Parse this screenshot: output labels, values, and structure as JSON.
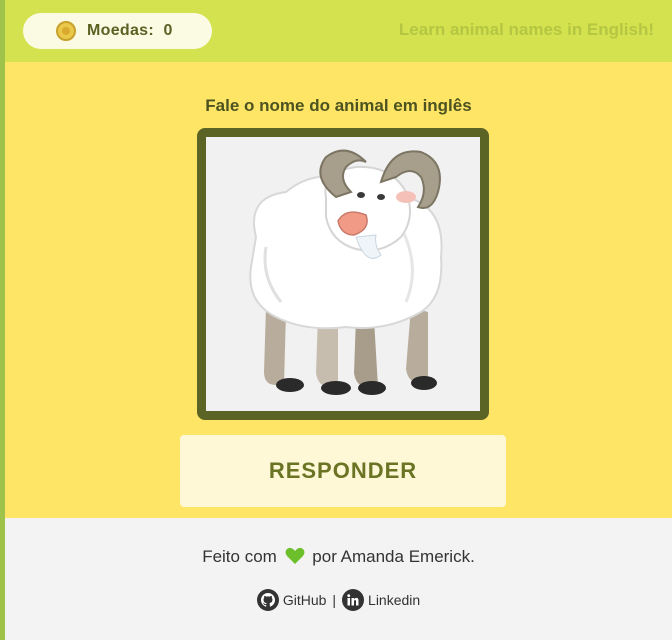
{
  "header": {
    "coins_label": "Moedas:",
    "coins_value": "0",
    "tagline": "Learn animal names in English!"
  },
  "main": {
    "instruction": "Fale o nome do animal em inglês",
    "animal_image": "goat-illustration",
    "respond_button": "RESPONDER"
  },
  "footer": {
    "made_prefix": "Feito com",
    "made_suffix": "por Amanda Emerick.",
    "heart_icon": "green-heart-icon",
    "github_label": "GitHub",
    "separator": "|",
    "linkedin_label": "Linkedin"
  },
  "colors": {
    "header_bg": "#d3e24e",
    "main_bg": "#ffe566",
    "frame_border": "#5b6425",
    "button_bg": "#fff8d6",
    "button_text": "#6b7424",
    "heart": "#6cbf2a"
  }
}
